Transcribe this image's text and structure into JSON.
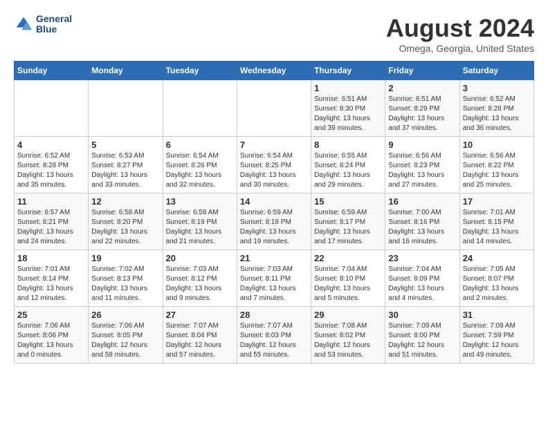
{
  "header": {
    "logo": {
      "line1": "General",
      "line2": "Blue"
    },
    "title": "August 2024",
    "location": "Omega, Georgia, United States"
  },
  "weekdays": [
    "Sunday",
    "Monday",
    "Tuesday",
    "Wednesday",
    "Thursday",
    "Friday",
    "Saturday"
  ],
  "weeks": [
    [
      {
        "day": "",
        "info": ""
      },
      {
        "day": "",
        "info": ""
      },
      {
        "day": "",
        "info": ""
      },
      {
        "day": "",
        "info": ""
      },
      {
        "day": "1",
        "info": "Sunrise: 6:51 AM\nSunset: 8:30 PM\nDaylight: 13 hours\nand 39 minutes."
      },
      {
        "day": "2",
        "info": "Sunrise: 6:51 AM\nSunset: 8:29 PM\nDaylight: 13 hours\nand 37 minutes."
      },
      {
        "day": "3",
        "info": "Sunrise: 6:52 AM\nSunset: 8:28 PM\nDaylight: 13 hours\nand 36 minutes."
      }
    ],
    [
      {
        "day": "4",
        "info": "Sunrise: 6:52 AM\nSunset: 8:28 PM\nDaylight: 13 hours\nand 35 minutes."
      },
      {
        "day": "5",
        "info": "Sunrise: 6:53 AM\nSunset: 8:27 PM\nDaylight: 13 hours\nand 33 minutes."
      },
      {
        "day": "6",
        "info": "Sunrise: 6:54 AM\nSunset: 8:26 PM\nDaylight: 13 hours\nand 32 minutes."
      },
      {
        "day": "7",
        "info": "Sunrise: 6:54 AM\nSunset: 8:25 PM\nDaylight: 13 hours\nand 30 minutes."
      },
      {
        "day": "8",
        "info": "Sunrise: 6:55 AM\nSunset: 8:24 PM\nDaylight: 13 hours\nand 29 minutes."
      },
      {
        "day": "9",
        "info": "Sunrise: 6:56 AM\nSunset: 8:23 PM\nDaylight: 13 hours\nand 27 minutes."
      },
      {
        "day": "10",
        "info": "Sunrise: 6:56 AM\nSunset: 8:22 PM\nDaylight: 13 hours\nand 25 minutes."
      }
    ],
    [
      {
        "day": "11",
        "info": "Sunrise: 6:57 AM\nSunset: 8:21 PM\nDaylight: 13 hours\nand 24 minutes."
      },
      {
        "day": "12",
        "info": "Sunrise: 6:58 AM\nSunset: 8:20 PM\nDaylight: 13 hours\nand 22 minutes."
      },
      {
        "day": "13",
        "info": "Sunrise: 6:58 AM\nSunset: 8:19 PM\nDaylight: 13 hours\nand 21 minutes."
      },
      {
        "day": "14",
        "info": "Sunrise: 6:59 AM\nSunset: 8:18 PM\nDaylight: 13 hours\nand 19 minutes."
      },
      {
        "day": "15",
        "info": "Sunrise: 6:59 AM\nSunset: 8:17 PM\nDaylight: 13 hours\nand 17 minutes."
      },
      {
        "day": "16",
        "info": "Sunrise: 7:00 AM\nSunset: 8:16 PM\nDaylight: 13 hours\nand 16 minutes."
      },
      {
        "day": "17",
        "info": "Sunrise: 7:01 AM\nSunset: 8:15 PM\nDaylight: 13 hours\nand 14 minutes."
      }
    ],
    [
      {
        "day": "18",
        "info": "Sunrise: 7:01 AM\nSunset: 8:14 PM\nDaylight: 13 hours\nand 12 minutes."
      },
      {
        "day": "19",
        "info": "Sunrise: 7:02 AM\nSunset: 8:13 PM\nDaylight: 13 hours\nand 11 minutes."
      },
      {
        "day": "20",
        "info": "Sunrise: 7:03 AM\nSunset: 8:12 PM\nDaylight: 13 hours\nand 9 minutes."
      },
      {
        "day": "21",
        "info": "Sunrise: 7:03 AM\nSunset: 8:11 PM\nDaylight: 13 hours\nand 7 minutes."
      },
      {
        "day": "22",
        "info": "Sunrise: 7:04 AM\nSunset: 8:10 PM\nDaylight: 13 hours\nand 5 minutes."
      },
      {
        "day": "23",
        "info": "Sunrise: 7:04 AM\nSunset: 8:09 PM\nDaylight: 13 hours\nand 4 minutes."
      },
      {
        "day": "24",
        "info": "Sunrise: 7:05 AM\nSunset: 8:07 PM\nDaylight: 13 hours\nand 2 minutes."
      }
    ],
    [
      {
        "day": "25",
        "info": "Sunrise: 7:06 AM\nSunset: 8:06 PM\nDaylight: 13 hours\nand 0 minutes."
      },
      {
        "day": "26",
        "info": "Sunrise: 7:06 AM\nSunset: 8:05 PM\nDaylight: 12 hours\nand 58 minutes."
      },
      {
        "day": "27",
        "info": "Sunrise: 7:07 AM\nSunset: 8:04 PM\nDaylight: 12 hours\nand 57 minutes."
      },
      {
        "day": "28",
        "info": "Sunrise: 7:07 AM\nSunset: 8:03 PM\nDaylight: 12 hours\nand 55 minutes."
      },
      {
        "day": "29",
        "info": "Sunrise: 7:08 AM\nSunset: 8:02 PM\nDaylight: 12 hours\nand 53 minutes."
      },
      {
        "day": "30",
        "info": "Sunrise: 7:09 AM\nSunset: 8:00 PM\nDaylight: 12 hours\nand 51 minutes."
      },
      {
        "day": "31",
        "info": "Sunrise: 7:09 AM\nSunset: 7:59 PM\nDaylight: 12 hours\nand 49 minutes."
      }
    ]
  ]
}
